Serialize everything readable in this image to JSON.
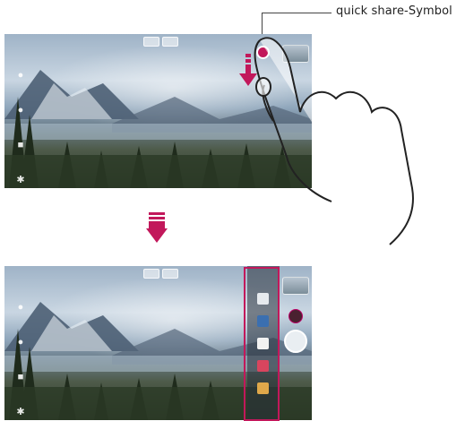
{
  "callout": {
    "label": "quick share-Symbol"
  },
  "icons": {
    "left_toolbar": [
      "person-icon",
      "people-icon",
      "gallery-icon",
      "settings-icon"
    ],
    "quick_share": "quick-share-icon"
  },
  "colors": {
    "accent": "#c2185b",
    "callout_line": "#444444"
  }
}
